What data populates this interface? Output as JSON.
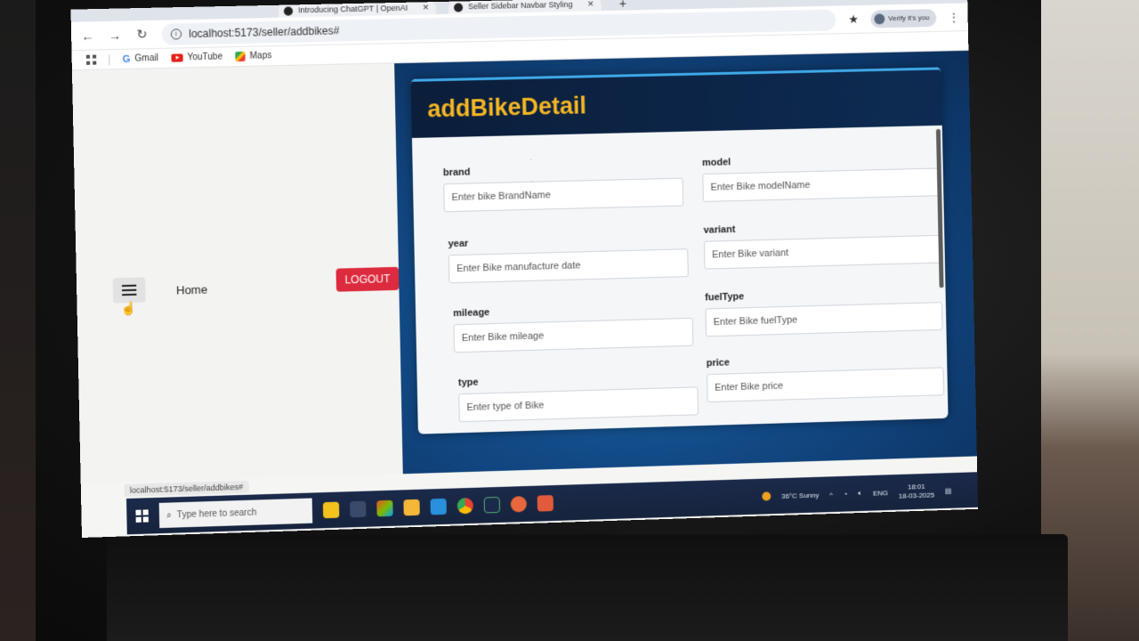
{
  "browser": {
    "tabs": [
      {
        "label": "Introducing ChatGPT | OpenAI",
        "close": "✕"
      },
      {
        "label": "Seller Sidebar Navbar Styling",
        "close": "✕"
      }
    ],
    "new_tab": "+",
    "url": "localhost:5173/seller/addbikes#",
    "profile": "Verify it's you",
    "bookmarks": [
      {
        "label": "Gmail",
        "icon": "gmail-icon"
      },
      {
        "label": "YouTube",
        "icon": "youtube-icon"
      },
      {
        "label": "Maps",
        "icon": "maps-icon"
      }
    ],
    "status_url": "localhost:5173/seller/addbikes#"
  },
  "sidebar": {
    "home_label": "Home",
    "logout_label": "LOGOUT",
    "logout_color": "#dc2b3e"
  },
  "form": {
    "title": "addBikeDetail",
    "title_color": "#f5b623",
    "fields": {
      "brand": {
        "label": "brand",
        "placeholder": "Enter bike BrandName"
      },
      "model": {
        "label": "model",
        "placeholder": "Enter Bike modelName"
      },
      "year": {
        "label": "year",
        "placeholder": "Enter Bike manufacture date"
      },
      "variant": {
        "label": "variant",
        "placeholder": "Enter Bike variant"
      },
      "mileage": {
        "label": "mileage",
        "placeholder": "Enter Bike mileage"
      },
      "fuelType": {
        "label": "fuelType",
        "placeholder": "Enter Bike fuelType"
      },
      "type": {
        "label": "type",
        "placeholder": "Enter type of Bike"
      },
      "price": {
        "label": "price",
        "placeholder": "Enter Bike price"
      }
    }
  },
  "taskbar": {
    "search_placeholder": "Type here to search",
    "weather": "36°C  Sunny",
    "lang": "ENG",
    "time": "18:01",
    "date": "18-03-2025"
  }
}
